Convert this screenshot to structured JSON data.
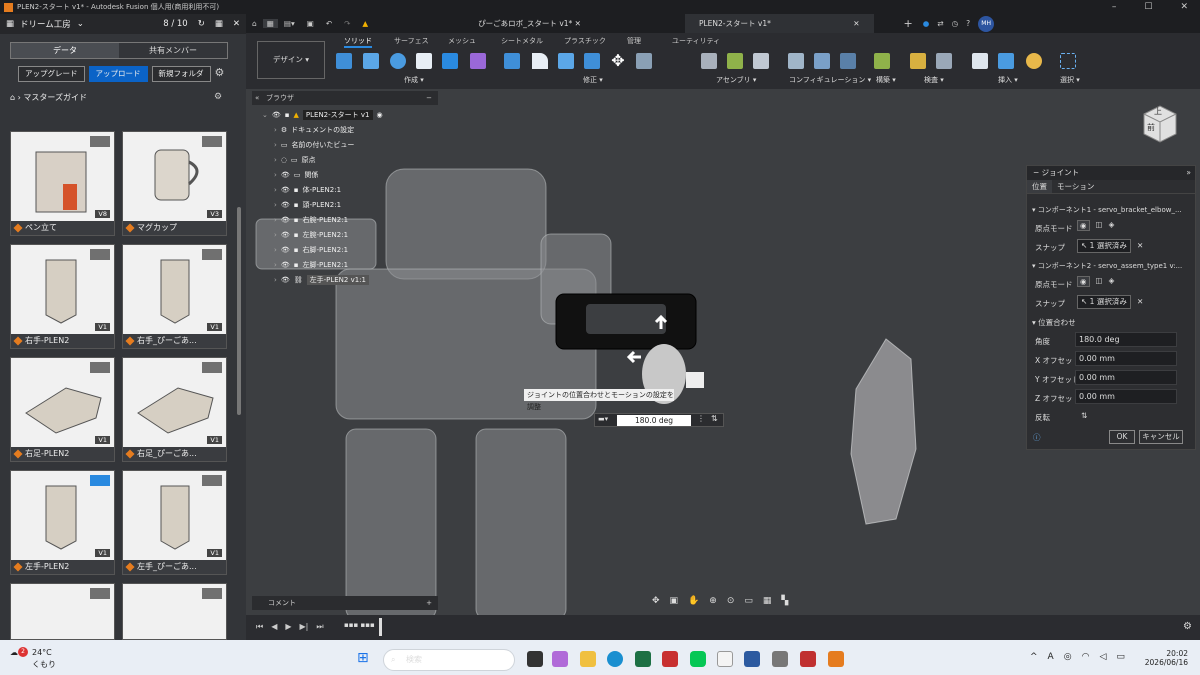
{
  "window": {
    "title": "PLEN2-スタート v1* - Autodesk Fusion 個人用(商用利用不可)"
  },
  "left_panel": {
    "team": "ドリーム工房",
    "count": "8 / 10",
    "tabs": [
      "データ",
      "共有メンバー"
    ],
    "buttons": {
      "upgrade": "アップグレード",
      "upload": "アップロード",
      "new_folder": "新規フォルダ"
    },
    "breadcrumb": "マスターズガイド",
    "thumbs": [
      {
        "label": "ペン立て",
        "ver": "V8"
      },
      {
        "label": "マグカップ",
        "ver": "V3"
      },
      {
        "label": "右手-PLEN2",
        "ver": "V1"
      },
      {
        "label": "右手_ぴーごあ...",
        "ver": "V1"
      },
      {
        "label": "右足-PLEN2",
        "ver": "V1"
      },
      {
        "label": "右足_ぴーごあ...",
        "ver": "V1"
      },
      {
        "label": "左手-PLEN2",
        "ver": "V1"
      },
      {
        "label": "左手_ぴーごあ...",
        "ver": "V1"
      }
    ]
  },
  "doc_tabs": [
    "ぴーごあロボ_スタート v1*",
    "PLEN2-スタート v1*"
  ],
  "ribbon": {
    "workspace": "デザイン",
    "tabs": [
      "ソリッド",
      "サーフェス",
      "メッシュ",
      "シートメタル",
      "プラスチック",
      "管理",
      "ユーティリティ"
    ],
    "groups": [
      "作成",
      "修正",
      "アセンブリ",
      "コンフィギュレーション",
      "構築",
      "検査",
      "挿入",
      "選択"
    ]
  },
  "browser": {
    "title": "ブラウザ",
    "root": "PLEN2-スタート v1",
    "items": [
      "ドキュメントの設定",
      "名前の付いたビュー",
      "原点",
      "関係",
      "体-PLEN2:1",
      "頭-PLEN2:1",
      "右腕-PLEN2:1",
      "左腕-PLEN2:1",
      "右脚-PLEN2:1",
      "左脚-PLEN2:1",
      "左手-PLEN2 v1:1"
    ]
  },
  "viewcube": {
    "top": "上",
    "front": "前"
  },
  "tooltip": "ジョイントの位置合わせとモーションの設定を調整",
  "angle_input": "180.0 deg",
  "joint_panel": {
    "title": "ジョイント",
    "tabs": [
      "位置",
      "モーション"
    ],
    "comp1": "コンポーネント1 - servo_bracket_elbow_...",
    "comp2": "コンポーネント2 - servo_assem_type1 v:...",
    "origin_mode": "原点モード",
    "snap": "スナップ",
    "snap_value": "1 選択済み",
    "align": "位置合わせ",
    "fields": [
      {
        "label": "角度",
        "value": "180.0 deg"
      },
      {
        "label": "X オフセット",
        "value": "0.00 mm"
      },
      {
        "label": "Y オフセット",
        "value": "0.00 mm"
      },
      {
        "label": "Z オフセット",
        "value": "0.00 mm"
      }
    ],
    "flip": "反転",
    "ok": "OK",
    "cancel": "キャンセル"
  },
  "comment": "コメント",
  "taskbar": {
    "weather_temp": "24°C",
    "weather_desc": "くもり",
    "search": "検索",
    "lang": "A",
    "time": "20:02",
    "date": "2026/06/16",
    "badge": "2"
  }
}
